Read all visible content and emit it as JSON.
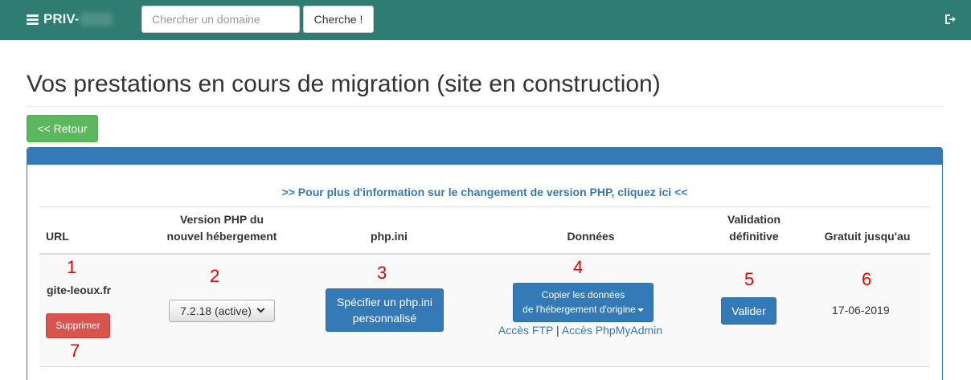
{
  "header": {
    "brand": "PRIV-",
    "search_placeholder": "Chercher un domaine",
    "search_button": "Cherche !"
  },
  "page": {
    "title": "Vos prestations en cours de migration (site en construction)",
    "back_button": "<< Retour",
    "php_info_link": ">> Pour plus d'information sur le changement de version PHP, cliquez ici <<"
  },
  "table": {
    "headers": {
      "url": "URL",
      "php_version_line1": "Version PHP du",
      "php_version_line2": "nouvel hébergement",
      "php_ini": "php.ini",
      "data": "Données",
      "validation_line1": "Validation",
      "validation_line2": "définitive",
      "free_until": "Gratuit jusqu'au"
    },
    "row": {
      "url": "gite-leoux.fr",
      "delete_button": "Supprimer",
      "php_version_selected": "7.2.18 (active)",
      "php_ini_button_line1": "Spécifier un php.ini",
      "php_ini_button_line2": "personnalisé",
      "copy_button_line1": "Copier les données",
      "copy_button_line2": "de l'hébergement d'origine",
      "ftp_link": "Accès FTP",
      "link_separator": "|",
      "phpmyadmin_link": "Accès PhpMyAdmin",
      "validate_button": "Valider",
      "free_until_date": "17-06-2019"
    }
  },
  "annotations": {
    "n1": "1",
    "n2": "2",
    "n3": "3",
    "n4": "4",
    "n5": "5",
    "n6": "6",
    "n7": "7"
  },
  "colors": {
    "topbar": "#2f7d72",
    "primary": "#337ab7",
    "success": "#5cb85c",
    "danger": "#d9534f",
    "annotation": "#e60000"
  }
}
